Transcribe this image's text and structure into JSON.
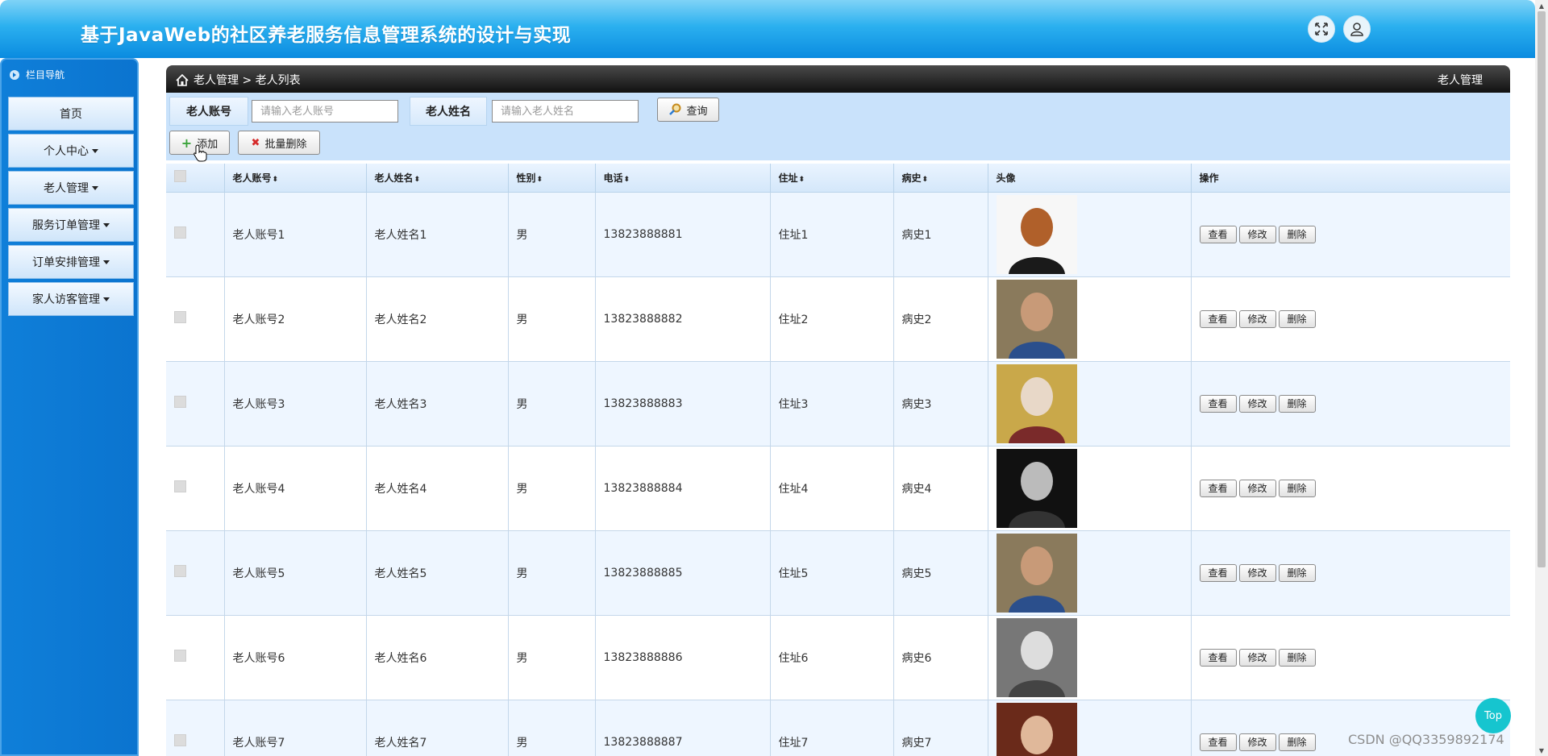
{
  "header": {
    "title": "基于JavaWeb的社区养老服务信息管理系统的设计与实现",
    "fullscreen_icon": "expand-icon",
    "user_icon": "user-icon"
  },
  "sidebar": {
    "heading": "栏目导航",
    "items": [
      {
        "label": "首页",
        "has_caret": false
      },
      {
        "label": "个人中心",
        "has_caret": true
      },
      {
        "label": "老人管理",
        "has_caret": true
      },
      {
        "label": "服务订单管理",
        "has_caret": true
      },
      {
        "label": "订单安排管理",
        "has_caret": true
      },
      {
        "label": "家人访客管理",
        "has_caret": true
      }
    ]
  },
  "breadcrumb": {
    "home_icon": "home-icon",
    "path": "老人管理 > 老人列表",
    "right_title": "老人管理"
  },
  "search": {
    "account_label": "老人账号",
    "account_placeholder": "请输入老人账号",
    "name_label": "老人姓名",
    "name_placeholder": "请输入老人姓名",
    "query_label": "查询",
    "add_label": "添加",
    "batch_delete_label": "批量删除"
  },
  "table": {
    "columns": [
      "老人账号",
      "老人姓名",
      "性别",
      "电话",
      "住址",
      "病史",
      "头像",
      "操作"
    ],
    "sortable": [
      true,
      true,
      true,
      true,
      true,
      true,
      false,
      false
    ],
    "action_labels": {
      "view": "查看",
      "edit": "修改",
      "delete": "删除"
    },
    "rows": [
      {
        "account": "老人账号1",
        "name": "老人姓名1",
        "gender": "男",
        "phone": "13823888881",
        "address": "住址1",
        "history": "病史1",
        "photo": "portrait-red-beard"
      },
      {
        "account": "老人账号2",
        "name": "老人姓名2",
        "gender": "男",
        "phone": "13823888882",
        "address": "住址2",
        "history": "病史2",
        "photo": "elder-blue-jacket"
      },
      {
        "account": "老人账号3",
        "name": "老人姓名3",
        "gender": "男",
        "phone": "13823888883",
        "address": "住址3",
        "history": "病史3",
        "photo": "elder-at-table"
      },
      {
        "account": "老人账号4",
        "name": "老人姓名4",
        "gender": "男",
        "phone": "13823888884",
        "address": "住址4",
        "history": "病史4",
        "photo": "elder-with-cup-bw"
      },
      {
        "account": "老人账号5",
        "name": "老人姓名5",
        "gender": "男",
        "phone": "13823888885",
        "address": "住址5",
        "history": "病史5",
        "photo": "elder-blue-jacket"
      },
      {
        "account": "老人账号6",
        "name": "老人姓名6",
        "gender": "男",
        "phone": "13823888886",
        "address": "住址6",
        "history": "病史6",
        "photo": "elder-face-bw"
      },
      {
        "account": "老人账号7",
        "name": "老人姓名7",
        "gender": "男",
        "phone": "13823888887",
        "address": "住址7",
        "history": "病史7",
        "photo": "elder-woman-red"
      }
    ]
  },
  "top_button": "Top",
  "watermark": "CSDN @QQ3359892174"
}
